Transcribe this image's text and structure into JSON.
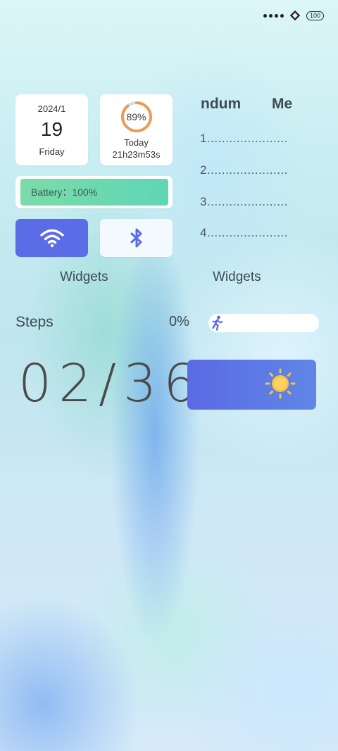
{
  "status_bar": {
    "battery": "100",
    "signal_icon": "signal-dots-icon",
    "network_icon": "network-diamond-icon"
  },
  "date_widget": {
    "year_month": "2024/1",
    "day": "19",
    "weekday": "Friday"
  },
  "ring_widget": {
    "percent_label": "89%",
    "percent_value": 89,
    "today_label": "Today",
    "elapsed": "21h23m53s",
    "ring_color": "#ee9a55"
  },
  "battery_widget": {
    "label": "Battery：100%",
    "level_percent": 100
  },
  "toggles": {
    "wifi_icon": "wifi-icon",
    "wifi_on": true,
    "bluetooth_icon": "bluetooth-icon",
    "bluetooth_on": false,
    "accent": "#5a6ce6"
  },
  "widget_labels": {
    "left": "Widgets",
    "right": "Widgets"
  },
  "memo": {
    "heading_left": "ndum",
    "heading_right": "Me",
    "lines": [
      "1......................",
      "2......................",
      "3......................",
      "4......................"
    ]
  },
  "steps": {
    "label": "Steps",
    "percent": "0%",
    "progress": 0,
    "runner_icon": "runner-icon"
  },
  "clock": {
    "time": "02/36"
  },
  "weather": {
    "icon": "sun-icon"
  }
}
